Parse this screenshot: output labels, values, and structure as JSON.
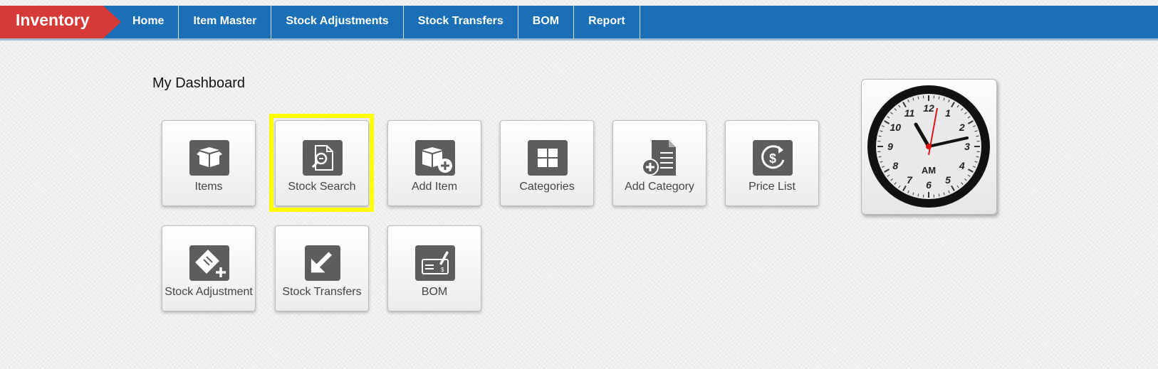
{
  "app": {
    "brand": "Inventory"
  },
  "nav": {
    "items": [
      {
        "label": "Home"
      },
      {
        "label": "Item Master"
      },
      {
        "label": "Stock Adjustments"
      },
      {
        "label": "Stock Transfers"
      },
      {
        "label": "BOM"
      },
      {
        "label": "Report"
      }
    ]
  },
  "dashboard": {
    "title": "My Dashboard",
    "tiles": [
      {
        "label": "Items",
        "icon": "boxes-icon"
      },
      {
        "label": "Stock Search",
        "icon": "document-search-icon",
        "highlighted": true
      },
      {
        "label": "Add Item",
        "icon": "boxes-add-icon"
      },
      {
        "label": "Categories",
        "icon": "grid-icon"
      },
      {
        "label": "Add Category",
        "icon": "document-add-icon"
      },
      {
        "label": "Price List",
        "icon": "dollar-refresh-icon"
      },
      {
        "label": "Stock Adjustment",
        "icon": "ticket-add-icon"
      },
      {
        "label": "Stock Transfers",
        "icon": "arrow-down-left-icon"
      },
      {
        "label": "BOM",
        "icon": "signature-check-icon"
      }
    ]
  },
  "clock": {
    "meridiem": "AM",
    "numerals": [
      "12",
      "1",
      "2",
      "3",
      "4",
      "5",
      "6",
      "7",
      "8",
      "9",
      "10",
      "11"
    ]
  },
  "colors": {
    "navbar": "#1a6fb6",
    "brand": "#d53a39",
    "highlight": "#ffff00",
    "icon": "#5d5d5d"
  }
}
